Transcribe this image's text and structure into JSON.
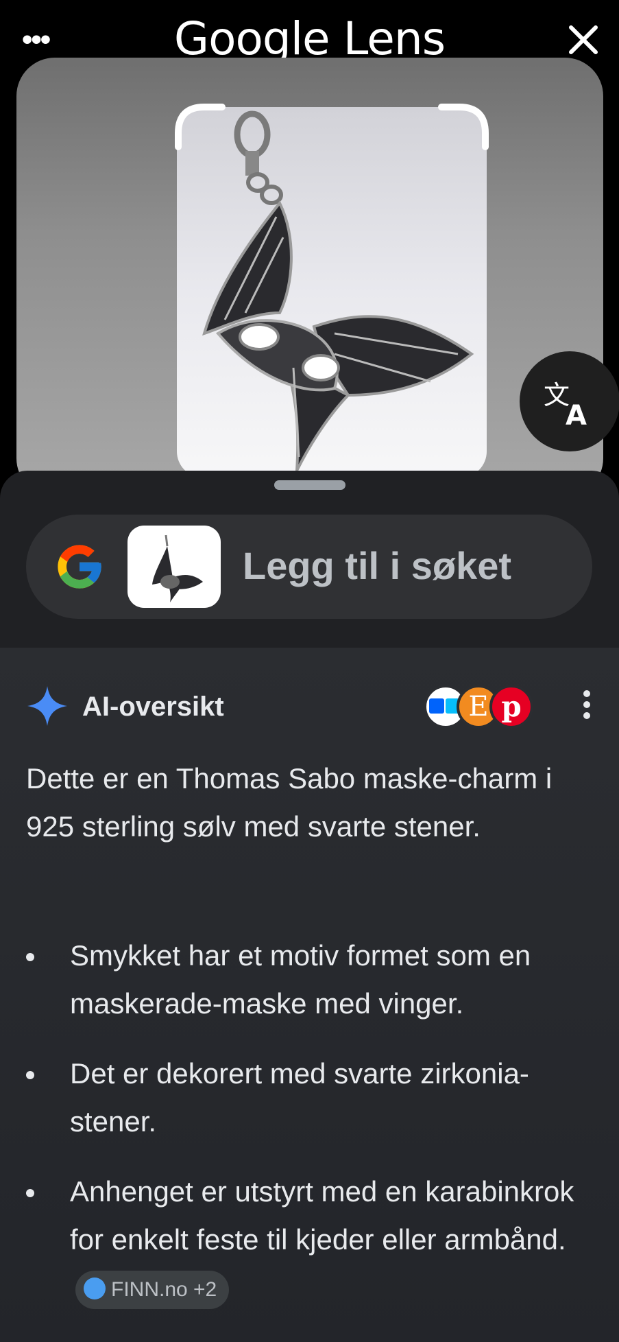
{
  "header": {
    "title": "Google Lens",
    "menu_icon": "more-horizontal-icon",
    "close_icon": "close-icon"
  },
  "image": {
    "translate_icon": "translate-icon"
  },
  "search": {
    "placeholder": "Legg til i søket",
    "logo_icon": "google-g-icon"
  },
  "ai_overview": {
    "label": "AI-oversikt",
    "summary": "Dette er en Thomas Sabo maske-charm i 925 sterling sølv med svarte stener.",
    "bullets": [
      "Smykket har et motiv formet som en maskerade-maske med vinger.",
      "Det er dekorert med svarte zirkonia-stener.",
      "Anhenget er utstyrt med en karabinkrok for enkelt feste til kjeder eller armbånd."
    ],
    "source_chip": "FINN.no +2",
    "source_icons": [
      "finn-icon",
      "etsy-icon",
      "pinterest-icon"
    ],
    "source_letters": [
      "E",
      "p"
    ]
  },
  "colors": {
    "sheet_bg": "#202124",
    "search_bg": "#303134",
    "sparkle": "#4a8cf6"
  }
}
